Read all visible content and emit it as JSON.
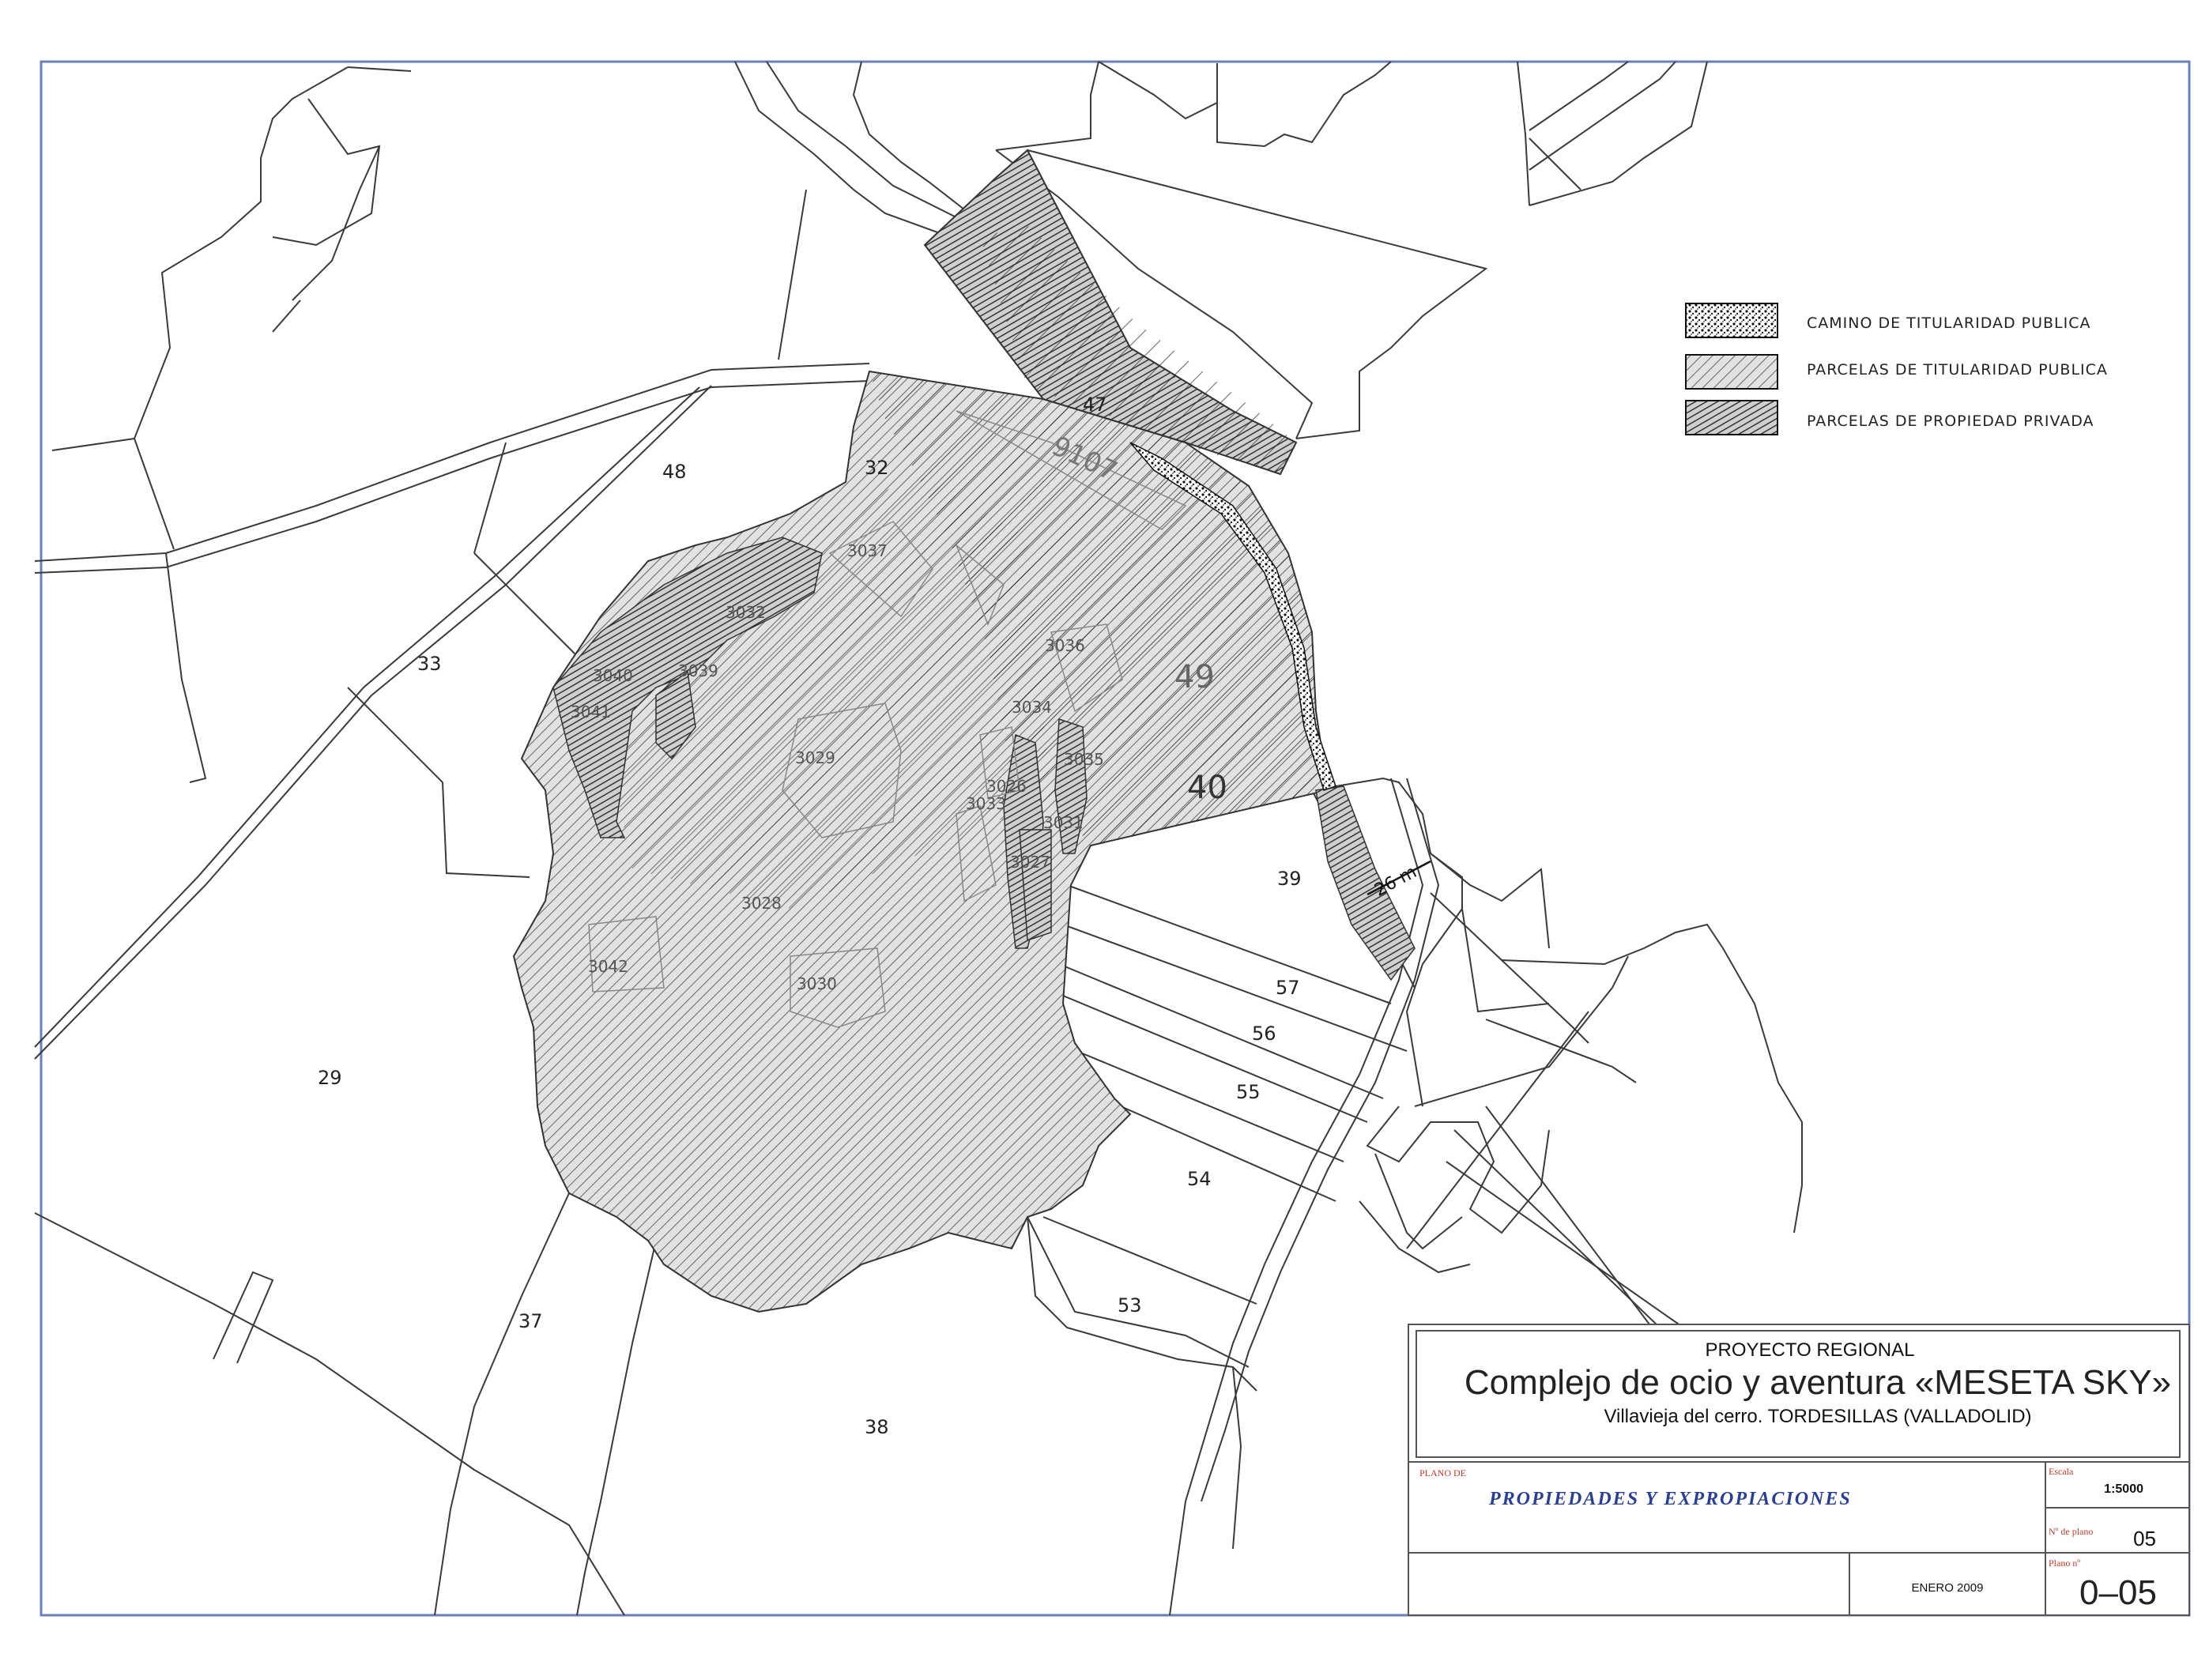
{
  "legend": [
    {
      "id": "public-road",
      "label": "CAMINO DE TITULARIDAD PUBLICA",
      "pattern": "dotted"
    },
    {
      "id": "public-parcel",
      "label": "PARCELAS DE TITULARIDAD PUBLICA",
      "pattern": "light-hatch"
    },
    {
      "id": "private-parcel",
      "label": "PARCELAS DE PROPIEDAD PRIVADA",
      "pattern": "dense-hatch"
    }
  ],
  "parcels": [
    "48",
    "33",
    "29",
    "37",
    "38",
    "53",
    "54",
    "55",
    "56",
    "57",
    "39",
    "32",
    "47",
    "49",
    "40"
  ],
  "subparcels": [
    "3037",
    "3032",
    "3036",
    "3034",
    "3035",
    "3040",
    "3039",
    "3041",
    "3029",
    "3028",
    "3042",
    "3030",
    "3026",
    "3033",
    "3031",
    "3027",
    "9107"
  ],
  "road_width": "26 m",
  "title_block": {
    "project_type": "PROYECTO REGIONAL",
    "project_name": "Complejo de ocio y aventura «MESETA SKY»",
    "location": "Villavieja del cerro. TORDESILLAS (VALLADOLID)",
    "plan_label": "PLANO DE",
    "plan_title": "PROPIEDADES Y EXPROPIACIONES",
    "scale_label": "Escala",
    "scale_value": "1:5000",
    "plan_number_label": "Nº de plano",
    "plan_number": "05",
    "date": "ENERO 2009",
    "sheet_label": "Plano nº",
    "sheet_number": "0–05"
  },
  "colors": {
    "line": "#3a3a3a",
    "hatch": "#555555",
    "accent_blue": "#2b3f8f",
    "accent_red": "#c0392b"
  }
}
